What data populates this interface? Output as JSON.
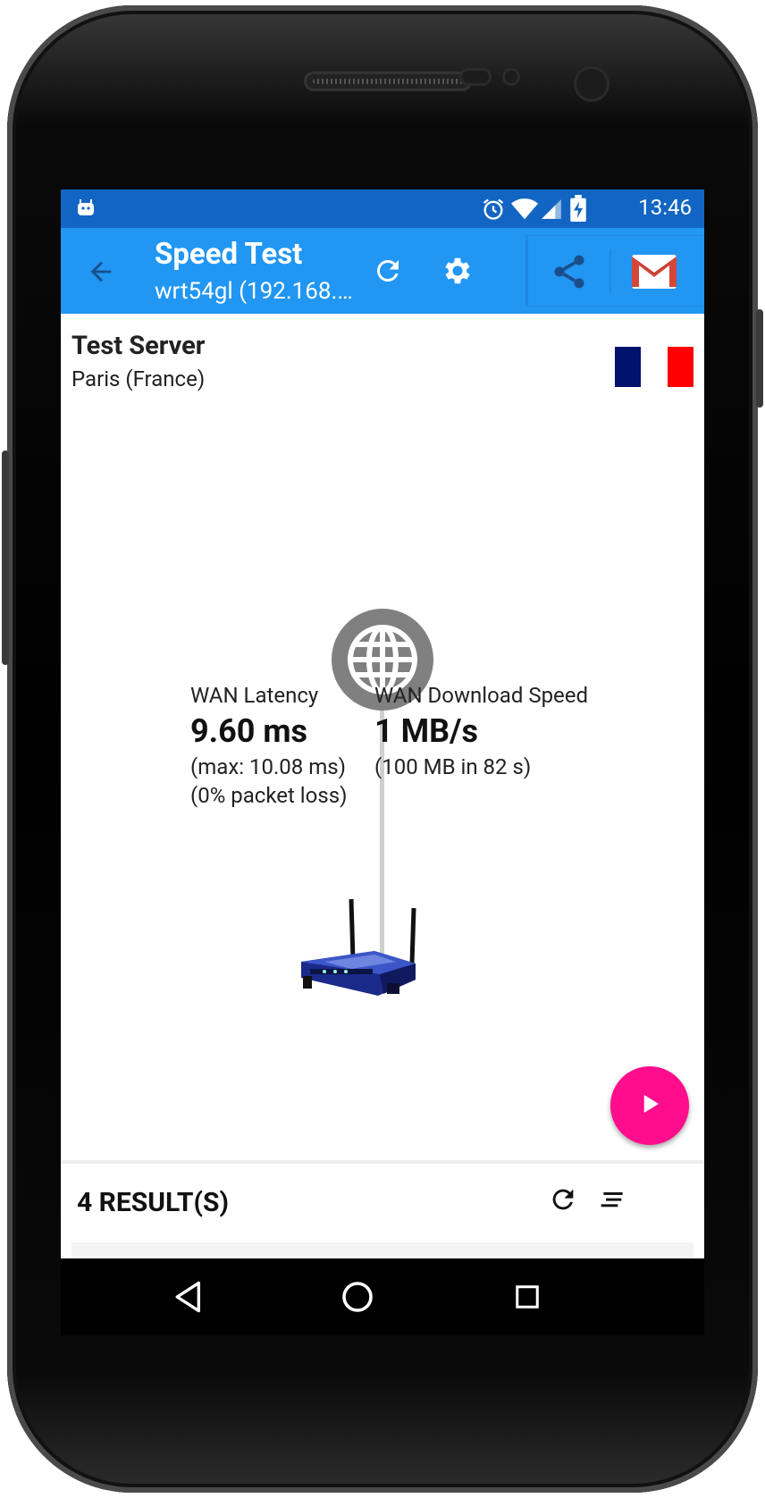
{
  "status_bar": {
    "time": "13:46"
  },
  "app_bar": {
    "title": "Speed Test",
    "subtitle": "wrt54gl (192.168.…"
  },
  "server": {
    "heading": "Test Server",
    "location": "Paris (France)",
    "flag_colors": [
      "#00126b",
      "#ffffff",
      "#ff0000"
    ]
  },
  "wan_latency": {
    "label": "WAN Latency",
    "value": "9.60 ms",
    "max": "(max: 10.08 ms)",
    "packet_loss": "(0% packet loss)"
  },
  "wan_download": {
    "label": "WAN Download Speed",
    "value": "1 MB/s",
    "detail": "(100 MB in 82 s)"
  },
  "results": {
    "count_label": "4 RESULT(S)"
  },
  "colors": {
    "status_bar": "#1265c2",
    "app_bar": "#2196f3",
    "fab": "#ff0d8d",
    "globe": "#808080"
  }
}
